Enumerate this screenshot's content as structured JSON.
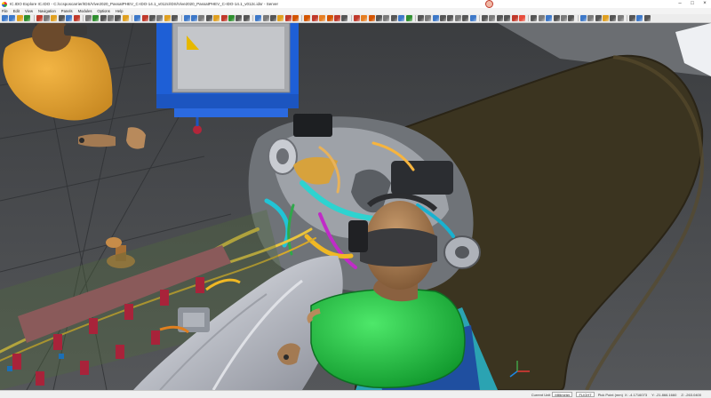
{
  "window": {
    "title": "IC.IDO Explore IC.IDO - C:/ccsposcarrier/IDS/Vive2020_PassatPHEV_C-IDO-14.1_v012c/IDS/Vive2020_PassatPHEV_C-IDO-14.1_v012c.idsr - Server",
    "minimize_glyph": "–",
    "maximize_glyph": "□",
    "close_glyph": "×"
  },
  "menu": [
    "File",
    "Edit",
    "View",
    "Navigation",
    "Panels",
    "Modules",
    "Options",
    "Help"
  ],
  "toolbar": {
    "colors": [
      "#3d78c8",
      "#3d78c8",
      "#e0a020",
      "#2f8f2f",
      "#c0392b",
      "#7a7a7a",
      "#e0a020",
      "#555555",
      "#3d78c8",
      "#c0392b",
      "#7a7a7a",
      "#2f8f2f",
      "#555555",
      "#7a7a7a",
      "#555555",
      "#e0a020",
      "#3d78c8",
      "#c0392b",
      "#555555",
      "#7a7a7a",
      "#e0a020",
      "#555555",
      "#3d78c8",
      "#3d78c8",
      "#7a7a7a",
      "#555555",
      "#e0a020",
      "#c0392b",
      "#2f8f2f",
      "#555555",
      "#555555",
      "#3d78c8",
      "#7a7a7a",
      "#555555",
      "#e0a020",
      "#c0392b",
      "#d35400",
      "#d35400",
      "#c0392b",
      "#e67e22",
      "#d35400",
      "#c0392b",
      "#555555",
      "#c0392b",
      "#e67e22",
      "#d35400",
      "#555555",
      "#7a7a7a",
      "#555555",
      "#3d78c8",
      "#2f8f2f",
      "#555555",
      "#7a7a7a",
      "#3d78c8",
      "#555555",
      "#555555",
      "#7a7a7a",
      "#555555",
      "#3d78c8",
      "#555555",
      "#7a7a7a",
      "#555555",
      "#555555",
      "#c0392b",
      "#e74c3c",
      "#555555",
      "#7a7a7a",
      "#3d78c8",
      "#555555",
      "#7a7a7a",
      "#555555",
      "#3d78c8",
      "#7a7a7a",
      "#555555",
      "#e0a020",
      "#555555",
      "#7a7a7a",
      "#555555",
      "#3d78c8",
      "#555555"
    ],
    "separators_after": [
      3,
      9,
      15,
      21,
      30,
      36,
      42,
      50,
      58,
      64,
      70,
      76
    ]
  },
  "status": {
    "current_unit_label": "Current Unit",
    "unit_value": "Millimeter",
    "mode_value": "FLIGHT",
    "pick_point_label": "Pick Point (mm)",
    "x_coord": "X: -4.1716073",
    "y_coord": "Y: -21.866.1660",
    "z_coord": "Z: -263.0400"
  }
}
